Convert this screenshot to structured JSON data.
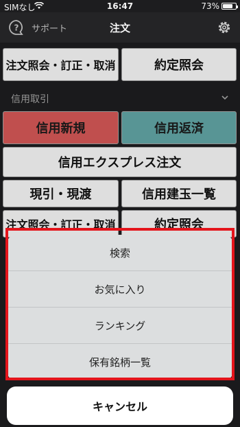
{
  "status_bar": {
    "carrier": "SIMなし",
    "time": "16:47",
    "battery": "73%"
  },
  "nav": {
    "support_label": "サポート",
    "title": "注文"
  },
  "top_row": {
    "left": "注文照会・訂正・取消",
    "right": "約定照会"
  },
  "section": {
    "label": "信用取引"
  },
  "credit": {
    "new": "信用新規",
    "repay": "信用返済",
    "express": "信用エクスプレス注文",
    "genbiki": "現引・現渡",
    "positions": "信用建玉一覧",
    "inquiry": "注文照会・訂正・取消",
    "execution": "約定照会"
  },
  "sheet": {
    "items": [
      "検索",
      "お気に入り",
      "ランキング",
      "保有銘柄一覧"
    ],
    "cancel": "キャンセル"
  },
  "colors": {
    "new_button": "#c85352",
    "repay_button": "#5c9c9c",
    "highlight": "#e4141b"
  }
}
